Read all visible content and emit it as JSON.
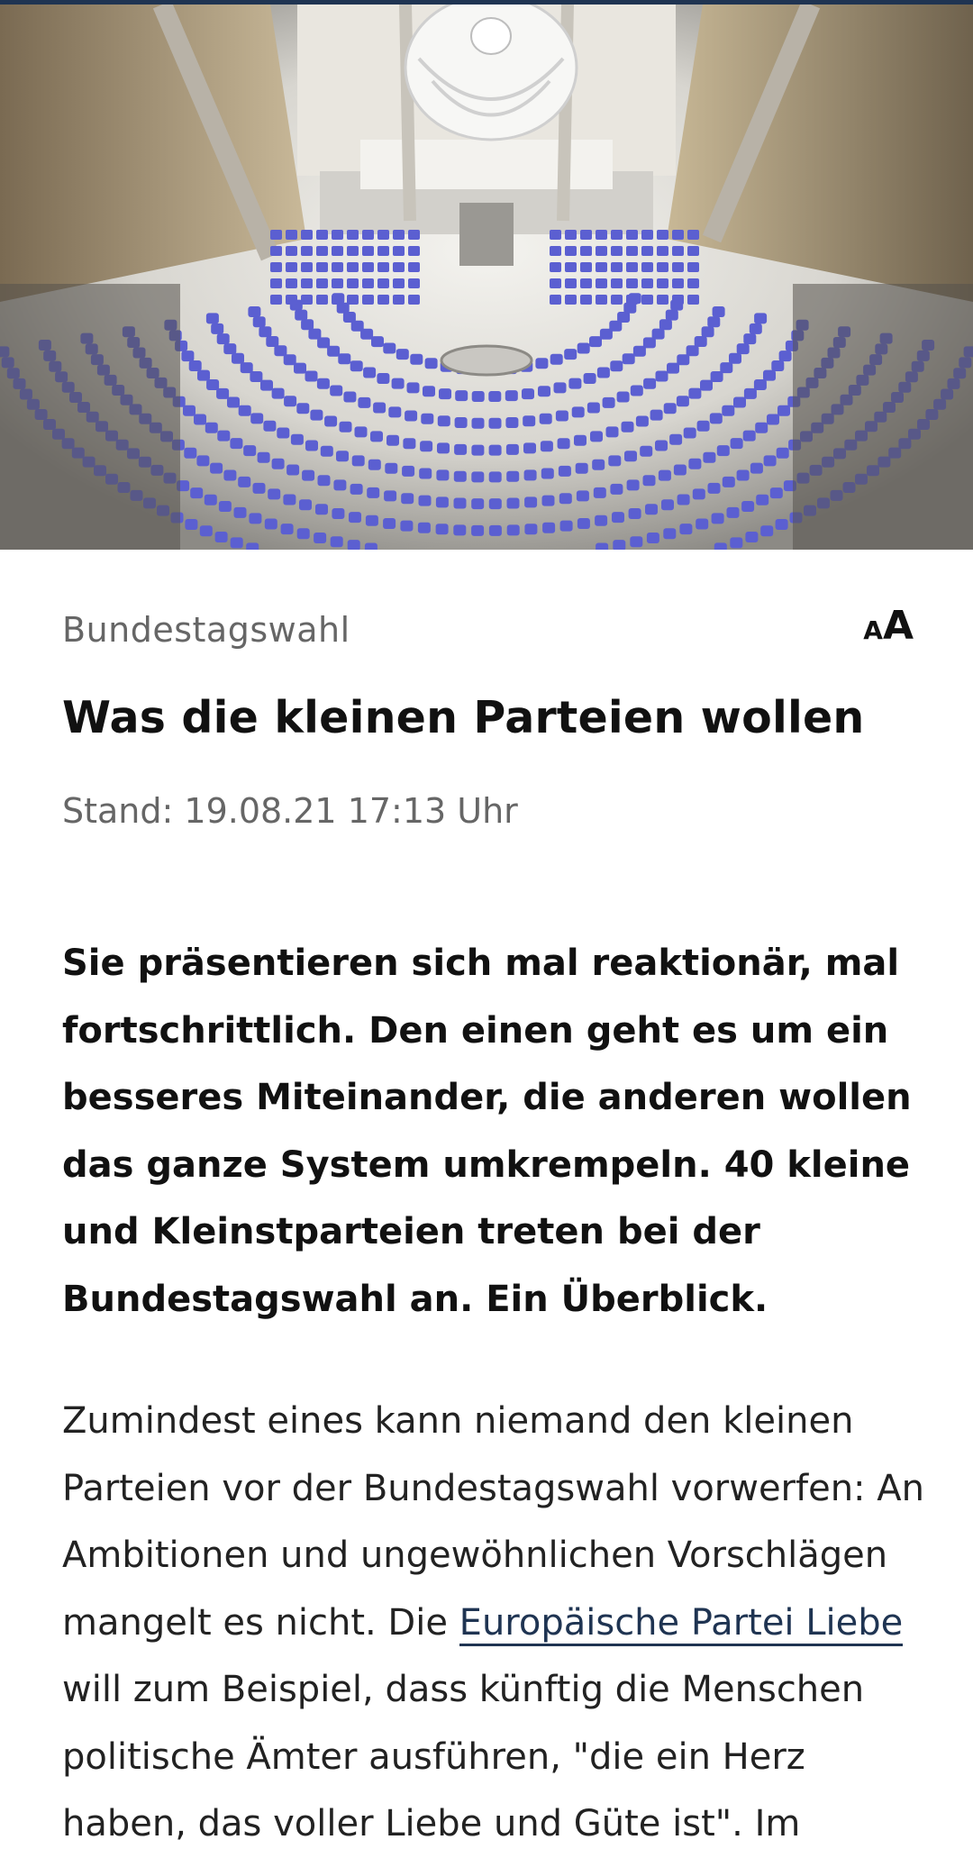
{
  "article": {
    "topline": "Bundestagswahl",
    "font_size_toggle": {
      "small": "A",
      "large": "A"
    },
    "headline": "Was die kleinen Parteien wollen",
    "date": "Stand: 19.08.21 17:13 Uhr",
    "teaser": "Sie präsentieren sich mal reaktionär, mal fortschrittlich. Den einen geht es um ein besseres Miteinander, die anderen wollen das ganze System umkrempeln. 40 kleine und Kleinstparteien treten bei der Bundestagswahl an. Ein Überblick.",
    "body": {
      "text_before_link": "Zumindest eines kann niemand den kleinen Parteien vor der Bundestagswahl vorwerfen: An Ambitionen und ungewöhnlichen Vorschlägen mangelt es nicht. Die ",
      "link_text": "Europäische Partei Liebe",
      "text_after_link": " will zum Beispiel, dass künftig die Menschen politische Ämter ausführen, \"die ein Herz haben, das voller Liebe und Güte ist\". Im"
    }
  },
  "colors": {
    "accent": "#1f3452",
    "meta_text": "#666666",
    "seat_blue": "#5b5fd1"
  }
}
